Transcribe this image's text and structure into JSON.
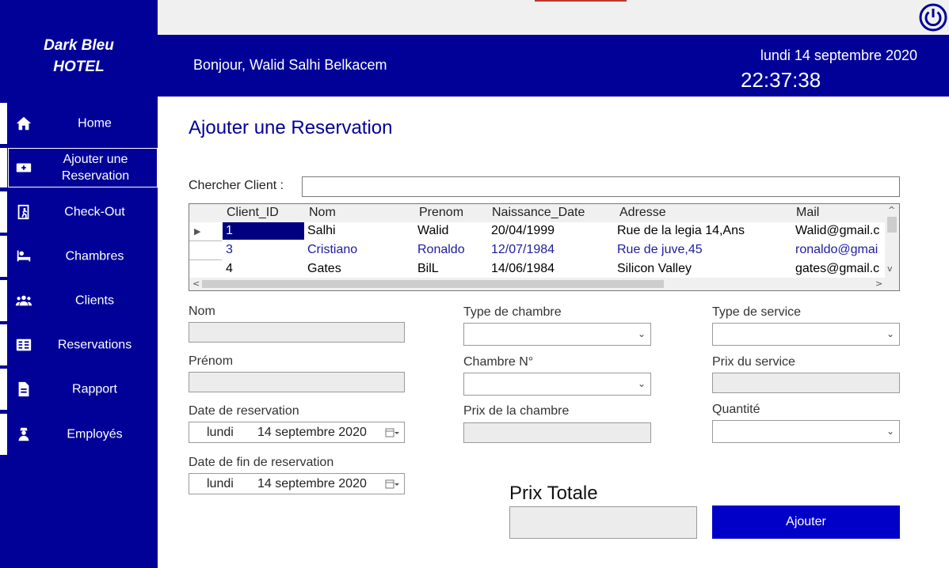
{
  "brand": {
    "line1": "Dark Bleu",
    "line2": "HOTEL"
  },
  "header": {
    "greeting": "Bonjour, Walid Salhi Belkacem",
    "date": "lundi 14 septembre 2020",
    "time": "22:37:38",
    "power_icon": "power-icon"
  },
  "sidebar": {
    "items": [
      {
        "label": "Home",
        "icon": "home-icon"
      },
      {
        "label": "Ajouter une Reservation",
        "icon": "add-ticket-icon"
      },
      {
        "label": "Check-Out",
        "icon": "exit-icon"
      },
      {
        "label": "Chambres",
        "icon": "bed-icon"
      },
      {
        "label": "Clients",
        "icon": "group-icon"
      },
      {
        "label": "Reservations",
        "icon": "list-icon"
      },
      {
        "label": "Rapport",
        "icon": "document-icon"
      },
      {
        "label": "Employés",
        "icon": "employee-icon"
      }
    ]
  },
  "main": {
    "title": "Ajouter une Reservation",
    "search_label": "Chercher Client :",
    "search_value": ""
  },
  "grid": {
    "columns": [
      "Client_ID",
      "Nom",
      "Prenom",
      "Naissance_Date",
      "Adresse",
      "Mail"
    ],
    "rows": [
      [
        "1",
        "Salhi",
        "Walid",
        "20/04/1999",
        "Rue de la legia 14,Ans",
        "Walid@gmail.c"
      ],
      [
        "3",
        "Cristiano",
        "Ronaldo",
        "12/07/1984",
        "Rue de juve,45",
        "ronaldo@gmai"
      ],
      [
        "4",
        "Gates",
        "BilL",
        "14/06/1984",
        "Silicon Valley",
        "gates@gmail.c"
      ]
    ]
  },
  "form": {
    "nom_label": "Nom",
    "prenom_label": "Prénom",
    "date_res_label": "Date de reservation",
    "date_res_day": "lundi",
    "date_res_date": "14 septembre 2020",
    "date_fin_label": "Date de fin de reservation",
    "date_fin_day": "lundi",
    "date_fin_date": "14 septembre 2020",
    "type_chambre_label": "Type de chambre",
    "chambre_no_label": "Chambre N°",
    "prix_chambre_label": "Prix de la chambre",
    "type_service_label": "Type de service",
    "prix_service_label": "Prix du service",
    "quantite_label": "Quantité",
    "prix_totale_label": "Prix Totale",
    "ajouter_label": "Ajouter"
  },
  "colors": {
    "primary": "#010198",
    "button": "#0000c8",
    "selection": "#000080"
  }
}
